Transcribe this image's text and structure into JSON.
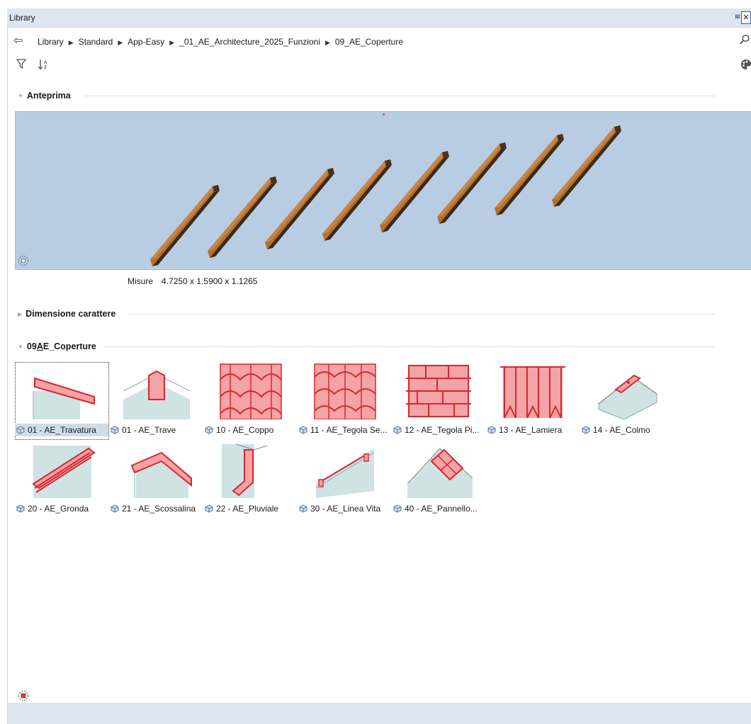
{
  "window": {
    "title": "Library",
    "pin_glyph": "⩏",
    "close_glyph": "✕"
  },
  "breadcrumb": {
    "back_icon": "back-arrow-icon",
    "items": [
      "Library",
      "Standard",
      "App-Easy",
      "_01_AE_Architecture_2025_Funzioni",
      "09_AE_Coperture"
    ],
    "search_icon": "search-icon"
  },
  "toolbar": {
    "filter_icon": "filter-icon",
    "sort_icon": "sort-az-icon",
    "palette_icon": "palette-icon"
  },
  "sections": {
    "preview_title": "Anteprima",
    "font_title": "Dimensione carattere",
    "folder_title": "09AE_Coperture"
  },
  "preview": {
    "measure_label": "Misure",
    "measure_value": "4.7250 x 1.5900 x 1.1265",
    "background_color": "#b8cde4",
    "beam_color": "#b2702f",
    "beam_count": 8
  },
  "items": [
    {
      "label": "01 - AE_Travatura",
      "thumb": "travatura",
      "selected": true
    },
    {
      "label": "01 - AE_Trave",
      "thumb": "trave"
    },
    {
      "label": "10 - AE_Coppo",
      "thumb": "coppo"
    },
    {
      "label": "11 - AE_Tegola Se...",
      "thumb": "tegola-se"
    },
    {
      "label": "12 - AE_Tegola Pi...",
      "thumb": "tegola-pi"
    },
    {
      "label": "13 - AE_Lamiera",
      "thumb": "lamiera"
    },
    {
      "label": "14 - AE_Colmo",
      "thumb": "colmo"
    },
    {
      "label": "20 - AE_Gronda",
      "thumb": "gronda"
    },
    {
      "label": "21 - AE_Scossalina",
      "thumb": "scossalina"
    },
    {
      "label": "22 - AE_Pluviale",
      "thumb": "pluviale"
    },
    {
      "label": "30 - AE_Linea Vita",
      "thumb": "linea-vita"
    },
    {
      "label": "40 - AE_Pannello...",
      "thumb": "pannello"
    }
  ],
  "colors": {
    "accent_red": "#d9262e",
    "thumb_fill": "#f4a3a6",
    "wall_fill": "#cfe2e4"
  }
}
